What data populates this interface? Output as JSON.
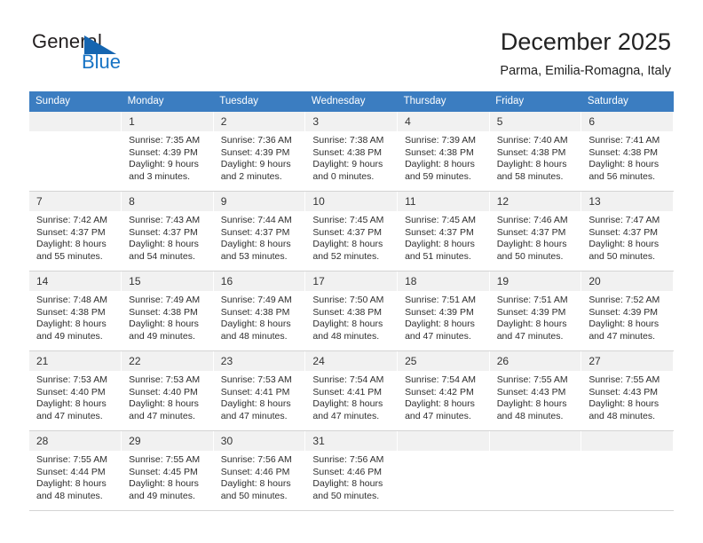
{
  "brand": {
    "name_top": "General",
    "name_bottom": "Blue",
    "triangle_color": "#1565b0",
    "blue_color": "#1773c4"
  },
  "header": {
    "title": "December 2025",
    "subtitle": "Parma, Emilia-Romagna, Italy"
  },
  "calendar": {
    "header_bg": "#3b7dc1",
    "daynum_bg": "#f1f1f1",
    "weekdays": [
      "Sunday",
      "Monday",
      "Tuesday",
      "Wednesday",
      "Thursday",
      "Friday",
      "Saturday"
    ],
    "weeks": [
      [
        {
          "empty": true,
          "day": ""
        },
        {
          "day": "1",
          "sunrise": "Sunrise: 7:35 AM",
          "sunset": "Sunset: 4:39 PM",
          "daylight_1": "Daylight: 9 hours",
          "daylight_2": "and 3 minutes."
        },
        {
          "day": "2",
          "sunrise": "Sunrise: 7:36 AM",
          "sunset": "Sunset: 4:39 PM",
          "daylight_1": "Daylight: 9 hours",
          "daylight_2": "and 2 minutes."
        },
        {
          "day": "3",
          "sunrise": "Sunrise: 7:38 AM",
          "sunset": "Sunset: 4:38 PM",
          "daylight_1": "Daylight: 9 hours",
          "daylight_2": "and 0 minutes."
        },
        {
          "day": "4",
          "sunrise": "Sunrise: 7:39 AM",
          "sunset": "Sunset: 4:38 PM",
          "daylight_1": "Daylight: 8 hours",
          "daylight_2": "and 59 minutes."
        },
        {
          "day": "5",
          "sunrise": "Sunrise: 7:40 AM",
          "sunset": "Sunset: 4:38 PM",
          "daylight_1": "Daylight: 8 hours",
          "daylight_2": "and 58 minutes."
        },
        {
          "day": "6",
          "sunrise": "Sunrise: 7:41 AM",
          "sunset": "Sunset: 4:38 PM",
          "daylight_1": "Daylight: 8 hours",
          "daylight_2": "and 56 minutes."
        }
      ],
      [
        {
          "day": "7",
          "sunrise": "Sunrise: 7:42 AM",
          "sunset": "Sunset: 4:37 PM",
          "daylight_1": "Daylight: 8 hours",
          "daylight_2": "and 55 minutes."
        },
        {
          "day": "8",
          "sunrise": "Sunrise: 7:43 AM",
          "sunset": "Sunset: 4:37 PM",
          "daylight_1": "Daylight: 8 hours",
          "daylight_2": "and 54 minutes."
        },
        {
          "day": "9",
          "sunrise": "Sunrise: 7:44 AM",
          "sunset": "Sunset: 4:37 PM",
          "daylight_1": "Daylight: 8 hours",
          "daylight_2": "and 53 minutes."
        },
        {
          "day": "10",
          "sunrise": "Sunrise: 7:45 AM",
          "sunset": "Sunset: 4:37 PM",
          "daylight_1": "Daylight: 8 hours",
          "daylight_2": "and 52 minutes."
        },
        {
          "day": "11",
          "sunrise": "Sunrise: 7:45 AM",
          "sunset": "Sunset: 4:37 PM",
          "daylight_1": "Daylight: 8 hours",
          "daylight_2": "and 51 minutes."
        },
        {
          "day": "12",
          "sunrise": "Sunrise: 7:46 AM",
          "sunset": "Sunset: 4:37 PM",
          "daylight_1": "Daylight: 8 hours",
          "daylight_2": "and 50 minutes."
        },
        {
          "day": "13",
          "sunrise": "Sunrise: 7:47 AM",
          "sunset": "Sunset: 4:37 PM",
          "daylight_1": "Daylight: 8 hours",
          "daylight_2": "and 50 minutes."
        }
      ],
      [
        {
          "day": "14",
          "sunrise": "Sunrise: 7:48 AM",
          "sunset": "Sunset: 4:38 PM",
          "daylight_1": "Daylight: 8 hours",
          "daylight_2": "and 49 minutes."
        },
        {
          "day": "15",
          "sunrise": "Sunrise: 7:49 AM",
          "sunset": "Sunset: 4:38 PM",
          "daylight_1": "Daylight: 8 hours",
          "daylight_2": "and 49 minutes."
        },
        {
          "day": "16",
          "sunrise": "Sunrise: 7:49 AM",
          "sunset": "Sunset: 4:38 PM",
          "daylight_1": "Daylight: 8 hours",
          "daylight_2": "and 48 minutes."
        },
        {
          "day": "17",
          "sunrise": "Sunrise: 7:50 AM",
          "sunset": "Sunset: 4:38 PM",
          "daylight_1": "Daylight: 8 hours",
          "daylight_2": "and 48 minutes."
        },
        {
          "day": "18",
          "sunrise": "Sunrise: 7:51 AM",
          "sunset": "Sunset: 4:39 PM",
          "daylight_1": "Daylight: 8 hours",
          "daylight_2": "and 47 minutes."
        },
        {
          "day": "19",
          "sunrise": "Sunrise: 7:51 AM",
          "sunset": "Sunset: 4:39 PM",
          "daylight_1": "Daylight: 8 hours",
          "daylight_2": "and 47 minutes."
        },
        {
          "day": "20",
          "sunrise": "Sunrise: 7:52 AM",
          "sunset": "Sunset: 4:39 PM",
          "daylight_1": "Daylight: 8 hours",
          "daylight_2": "and 47 minutes."
        }
      ],
      [
        {
          "day": "21",
          "sunrise": "Sunrise: 7:53 AM",
          "sunset": "Sunset: 4:40 PM",
          "daylight_1": "Daylight: 8 hours",
          "daylight_2": "and 47 minutes."
        },
        {
          "day": "22",
          "sunrise": "Sunrise: 7:53 AM",
          "sunset": "Sunset: 4:40 PM",
          "daylight_1": "Daylight: 8 hours",
          "daylight_2": "and 47 minutes."
        },
        {
          "day": "23",
          "sunrise": "Sunrise: 7:53 AM",
          "sunset": "Sunset: 4:41 PM",
          "daylight_1": "Daylight: 8 hours",
          "daylight_2": "and 47 minutes."
        },
        {
          "day": "24",
          "sunrise": "Sunrise: 7:54 AM",
          "sunset": "Sunset: 4:41 PM",
          "daylight_1": "Daylight: 8 hours",
          "daylight_2": "and 47 minutes."
        },
        {
          "day": "25",
          "sunrise": "Sunrise: 7:54 AM",
          "sunset": "Sunset: 4:42 PM",
          "daylight_1": "Daylight: 8 hours",
          "daylight_2": "and 47 minutes."
        },
        {
          "day": "26",
          "sunrise": "Sunrise: 7:55 AM",
          "sunset": "Sunset: 4:43 PM",
          "daylight_1": "Daylight: 8 hours",
          "daylight_2": "and 48 minutes."
        },
        {
          "day": "27",
          "sunrise": "Sunrise: 7:55 AM",
          "sunset": "Sunset: 4:43 PM",
          "daylight_1": "Daylight: 8 hours",
          "daylight_2": "and 48 minutes."
        }
      ],
      [
        {
          "day": "28",
          "sunrise": "Sunrise: 7:55 AM",
          "sunset": "Sunset: 4:44 PM",
          "daylight_1": "Daylight: 8 hours",
          "daylight_2": "and 48 minutes."
        },
        {
          "day": "29",
          "sunrise": "Sunrise: 7:55 AM",
          "sunset": "Sunset: 4:45 PM",
          "daylight_1": "Daylight: 8 hours",
          "daylight_2": "and 49 minutes."
        },
        {
          "day": "30",
          "sunrise": "Sunrise: 7:56 AM",
          "sunset": "Sunset: 4:46 PM",
          "daylight_1": "Daylight: 8 hours",
          "daylight_2": "and 50 minutes."
        },
        {
          "day": "31",
          "sunrise": "Sunrise: 7:56 AM",
          "sunset": "Sunset: 4:46 PM",
          "daylight_1": "Daylight: 8 hours",
          "daylight_2": "and 50 minutes."
        },
        {
          "empty": true,
          "day": ""
        },
        {
          "empty": true,
          "day": ""
        },
        {
          "empty": true,
          "day": ""
        }
      ]
    ]
  }
}
